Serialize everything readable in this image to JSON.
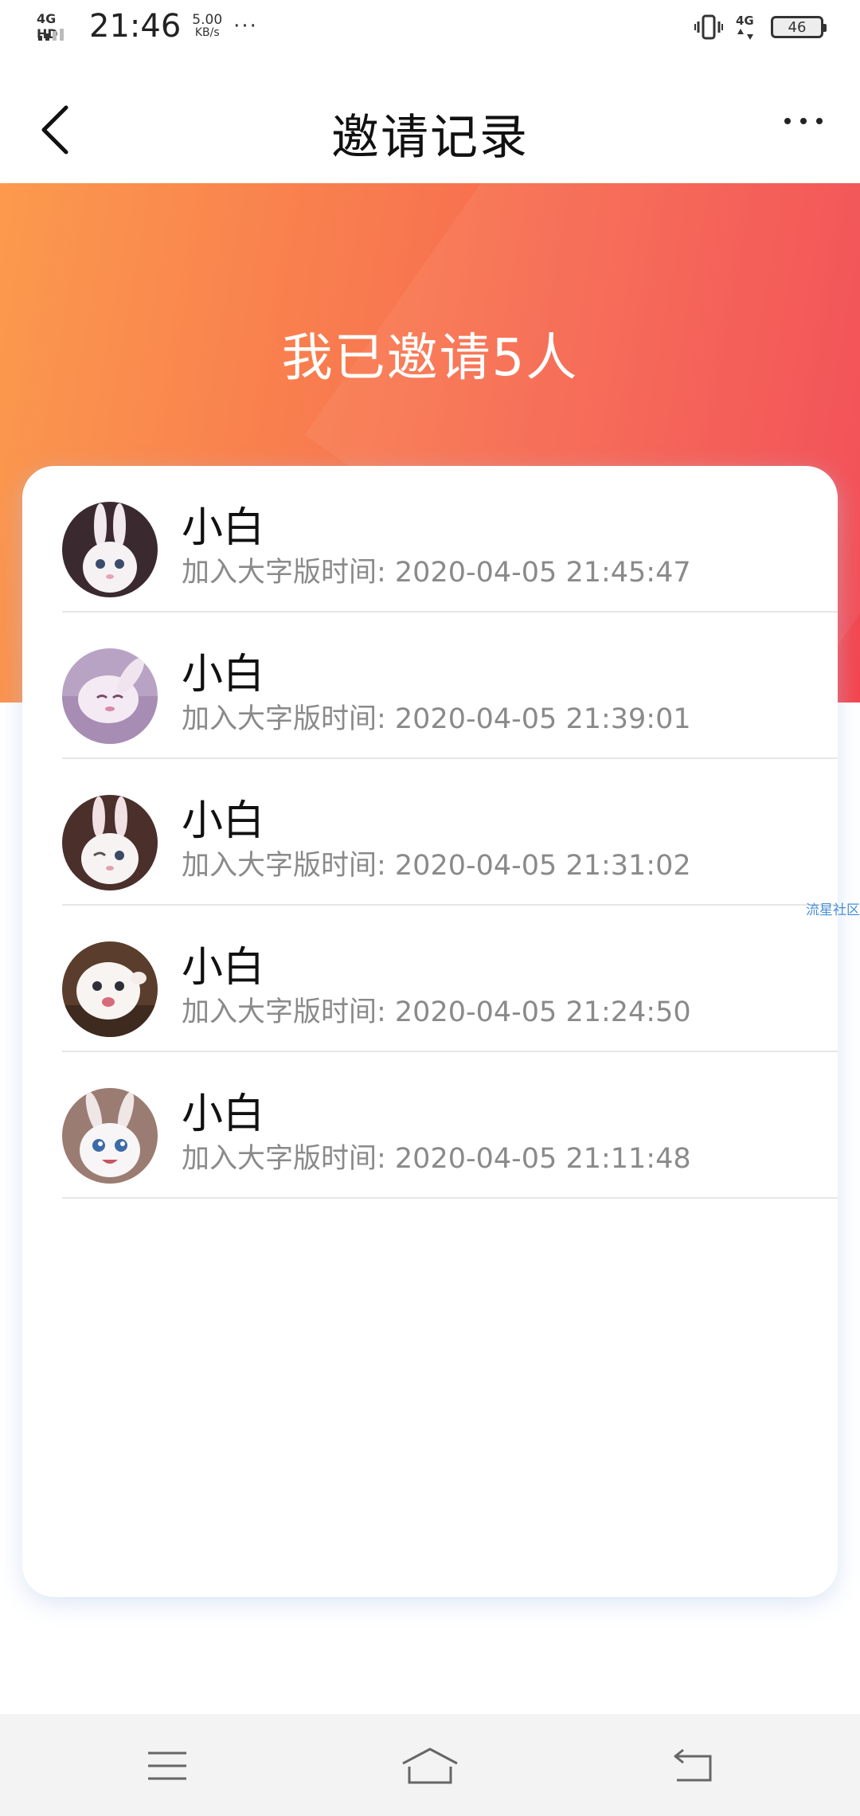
{
  "status_bar": {
    "network_label": "4G HD",
    "time": "21:46",
    "speed_value": "5.00",
    "speed_unit": "KB/s",
    "more": "···",
    "signal_label": "4G",
    "battery": "46"
  },
  "nav": {
    "title": "邀请记录",
    "back_icon": "chevron-left-icon",
    "more_icon": "more-dots-icon"
  },
  "hero": {
    "title": "我已邀请5人",
    "gradient_start": "#fb9a4d",
    "gradient_end": "#f2454f"
  },
  "invites": [
    {
      "name": "小白",
      "joined": "加入大字版时间: 2020-04-05 21:45:47"
    },
    {
      "name": "小白",
      "joined": "加入大字版时间: 2020-04-05 21:39:01"
    },
    {
      "name": "小白",
      "joined": "加入大字版时间: 2020-04-05 21:31:02"
    },
    {
      "name": "小白",
      "joined": "加入大字版时间: 2020-04-05 21:24:50"
    },
    {
      "name": "小白",
      "joined": "加入大字版时间: 2020-04-05 21:11:48"
    }
  ],
  "watermark": "流星社区",
  "bottom_nav": {
    "menu_icon": "menu-icon",
    "home_icon": "home-icon",
    "back_icon": "back-icon"
  }
}
